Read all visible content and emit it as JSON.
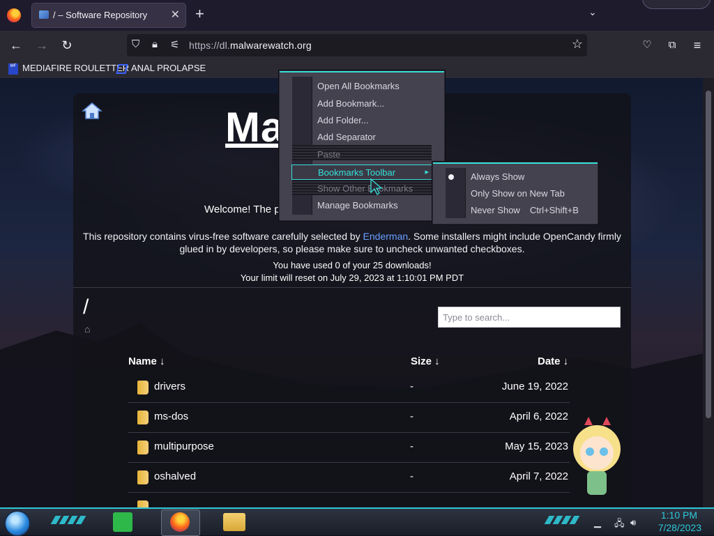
{
  "browser": {
    "tab_title": "/ – Software Repository",
    "tab_close": "✕",
    "new_tab": "+",
    "tab_list": "⌄",
    "url_prefix": "https://dl.",
    "url_domain": "malwarewatch.org",
    "bookmarks": [
      {
        "label": "MEDIAFIRE ROULETTER",
        "icon": "MF"
      },
      {
        "label": "ANAL PROLAPSE",
        "icon": ""
      }
    ]
  },
  "page": {
    "logo": "Ma",
    "welcome": "Welcome! The p",
    "description_prefix": "This repository contains virus-free software carefully selected by ",
    "description_link": "Enderman",
    "description_suffix": ". Some installers might include OpenCandy firmly glued in by developers, so please make sure to uncheck unwanted checkboxes.",
    "usage_line1": "You have used 0 of your 25 downloads!",
    "usage_line2": "Your limit will reset on July 29, 2023 at 1:10:01 PM PDT",
    "path": "/",
    "search_placeholder": "Type to search...",
    "columns": {
      "name": "Name ↓",
      "size": "Size ↓",
      "date": "Date ↓"
    },
    "rows": [
      {
        "name": "drivers",
        "size": "-",
        "date": "June 19, 2022"
      },
      {
        "name": "ms-dos",
        "size": "-",
        "date": "April 6, 2022"
      },
      {
        "name": "multipurpose",
        "size": "-",
        "date": "May 15, 2023"
      },
      {
        "name": "oshalved",
        "size": "-",
        "date": "April 7, 2022"
      }
    ]
  },
  "context_menu": {
    "items": [
      {
        "label": "Open All Bookmarks",
        "state": "normal"
      },
      {
        "label": "Add Bookmark...",
        "state": "normal"
      },
      {
        "label": "Add Folder...",
        "state": "normal"
      },
      {
        "label": "Add Separator",
        "state": "normal"
      },
      {
        "label": "Paste",
        "state": "disabled"
      },
      {
        "label": "Bookmarks Toolbar",
        "state": "active"
      },
      {
        "label": "Show Other Bookmarks",
        "state": "disabled"
      },
      {
        "label": "Manage Bookmarks",
        "state": "normal"
      }
    ]
  },
  "submenu": {
    "items": [
      {
        "label": "Always Show",
        "checked": true,
        "shortcut": ""
      },
      {
        "label": "Only Show on New Tab",
        "checked": false,
        "shortcut": ""
      },
      {
        "label": "Never Show",
        "checked": false,
        "shortcut": "Ctrl+Shift+B"
      }
    ]
  },
  "taskbar": {
    "time": "1:10 PM",
    "date": "7/28/2023"
  },
  "colors": {
    "accent_cyan": "#37e0d8",
    "link": "#6aa0ff"
  }
}
